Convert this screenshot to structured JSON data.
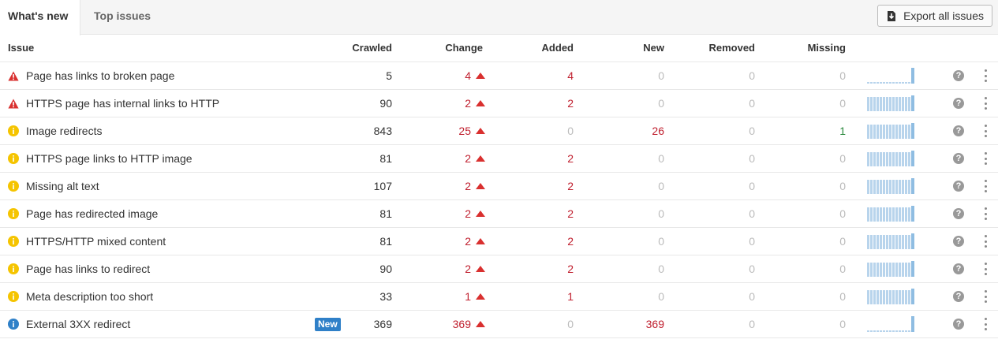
{
  "tabs": [
    {
      "label": "What's new",
      "active": true
    },
    {
      "label": "Top issues",
      "active": false
    }
  ],
  "export_button": {
    "label": "Export all issues",
    "icon": "download-icon"
  },
  "columns": {
    "issue": "Issue",
    "crawled": "Crawled",
    "change": "Change",
    "added": "Added",
    "new": "New",
    "removed": "Removed",
    "missing": "Missing"
  },
  "colors": {
    "error": "#d9302f",
    "warning": "#f5c400",
    "notice": "#2f80c8",
    "red_number": "#c0202f",
    "green_number": "#2b8a3e",
    "spark": "#b8d4ec"
  },
  "rows": [
    {
      "severity": "error",
      "icon": "error-triangle-icon",
      "label": "Page has links to broken page",
      "badge": "",
      "crawled": "5",
      "change": "4",
      "added": "4",
      "new": "0",
      "removed": "0",
      "missing": "0",
      "spark": "low"
    },
    {
      "severity": "error",
      "icon": "error-triangle-icon",
      "label": "HTTPS page has internal links to HTTP",
      "badge": "",
      "crawled": "90",
      "change": "2",
      "added": "2",
      "new": "0",
      "removed": "0",
      "missing": "0",
      "spark": "high"
    },
    {
      "severity": "warning",
      "icon": "warning-circle-icon",
      "label": "Image redirects",
      "badge": "",
      "crawled": "843",
      "change": "25",
      "added": "0",
      "new": "26",
      "removed": "0",
      "missing": "1",
      "spark": "high"
    },
    {
      "severity": "warning",
      "icon": "warning-circle-icon",
      "label": "HTTPS page links to HTTP image",
      "badge": "",
      "crawled": "81",
      "change": "2",
      "added": "2",
      "new": "0",
      "removed": "0",
      "missing": "0",
      "spark": "high"
    },
    {
      "severity": "warning",
      "icon": "warning-circle-icon",
      "label": "Missing alt text",
      "badge": "",
      "crawled": "107",
      "change": "2",
      "added": "2",
      "new": "0",
      "removed": "0",
      "missing": "0",
      "spark": "high"
    },
    {
      "severity": "warning",
      "icon": "warning-circle-icon",
      "label": "Page has redirected image",
      "badge": "",
      "crawled": "81",
      "change": "2",
      "added": "2",
      "new": "0",
      "removed": "0",
      "missing": "0",
      "spark": "high"
    },
    {
      "severity": "warning",
      "icon": "warning-circle-icon",
      "label": "HTTPS/HTTP mixed content",
      "badge": "",
      "crawled": "81",
      "change": "2",
      "added": "2",
      "new": "0",
      "removed": "0",
      "missing": "0",
      "spark": "high"
    },
    {
      "severity": "warning",
      "icon": "warning-circle-icon",
      "label": "Page has links to redirect",
      "badge": "",
      "crawled": "90",
      "change": "2",
      "added": "2",
      "new": "0",
      "removed": "0",
      "missing": "0",
      "spark": "high"
    },
    {
      "severity": "warning",
      "icon": "warning-circle-icon",
      "label": "Meta description too short",
      "badge": "",
      "crawled": "33",
      "change": "1",
      "added": "1",
      "new": "0",
      "removed": "0",
      "missing": "0",
      "spark": "high"
    },
    {
      "severity": "notice",
      "icon": "info-circle-icon",
      "label": "External 3XX redirect",
      "badge": "New",
      "crawled": "369",
      "change": "369",
      "added": "0",
      "new": "369",
      "removed": "0",
      "missing": "0",
      "spark": "low"
    }
  ]
}
